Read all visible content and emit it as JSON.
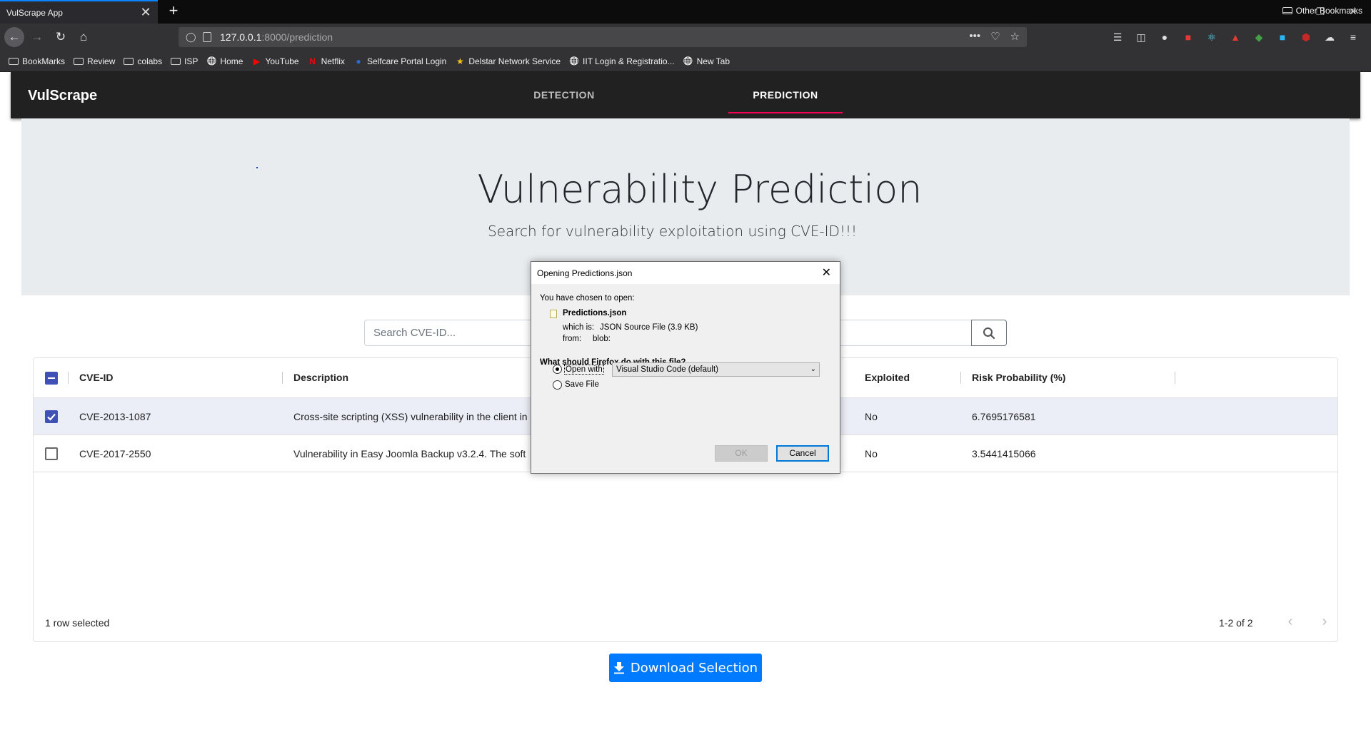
{
  "browser": {
    "tab_title": "VulScrape App",
    "tab_close": "✕",
    "new_tab": "+",
    "url_host": "127.0.0.1",
    "url_rest": ":8000/prediction",
    "url_dots": "•••",
    "bookmarks": [
      {
        "label": "BookMarks",
        "icon": "folder-icon"
      },
      {
        "label": "Review",
        "icon": "folder-icon"
      },
      {
        "label": "colabs",
        "icon": "folder-icon"
      },
      {
        "label": "ISP",
        "icon": "folder-icon"
      },
      {
        "label": "Home",
        "icon": "globe-icon"
      },
      {
        "label": "YouTube",
        "icon": "youtube-icon"
      },
      {
        "label": "Netflix",
        "icon": "netflix-icon"
      },
      {
        "label": "Selfcare Portal Login",
        "icon": "icr-icon"
      },
      {
        "label": "Delstar Network Service",
        "icon": "star-icon"
      },
      {
        "label": "IIT Login & Registratio...",
        "icon": "globe-icon"
      },
      {
        "label": "New Tab",
        "icon": "globe-icon"
      }
    ],
    "other_bookmarks": "Other Bookmarks"
  },
  "app": {
    "brand": "VulScrape",
    "tabs": [
      {
        "label": "DETECTION",
        "active": false
      },
      {
        "label": "PREDICTION",
        "active": true
      }
    ],
    "hero_title": "Vulnerability Prediction",
    "hero_subtitle": "Search for vulnerability exploitation using CVE-ID!!!",
    "search_placeholder": "Search CVE-ID...",
    "grid": {
      "columns": [
        "CVE-ID",
        "Description",
        "Exploited",
        "Risk Probability (%)"
      ],
      "rows": [
        {
          "selected": true,
          "cve": "CVE-2013-1087",
          "description": "Cross-site scripting (XSS) vulnerability in the client in",
          "exploited": "No",
          "risk": "6.7695176581"
        },
        {
          "selected": false,
          "cve": "CVE-2017-2550",
          "description": "Vulnerability in Easy Joomla Backup v3.2.4. The soft",
          "exploited": "No",
          "risk": "3.5441415066"
        }
      ],
      "footer_selected": "1 row selected",
      "pagination": "1-2 of 2",
      "prev": "‹",
      "next": "›"
    },
    "download_label": "Download Selection"
  },
  "dialog": {
    "title": "Opening Predictions.json",
    "close": "✕",
    "intro": "You have chosen to open:",
    "filename": "Predictions.json",
    "which_is_label": "which is:",
    "which_is_value": "JSON Source File (3.9 KB)",
    "from_label": "from:",
    "from_value": "blob:",
    "question": "What should Firefox do with this file?",
    "open_with_label": "Open with",
    "open_with_value": "Visual Studio Code (default)",
    "save_file_label": "Save File",
    "ok_label": "OK",
    "cancel_label": "Cancel"
  },
  "colors": {
    "accent_primary": "#3f51b5",
    "tab_indicator": "#f50057",
    "download_button": "#007bff",
    "app_bar": "#212121"
  }
}
